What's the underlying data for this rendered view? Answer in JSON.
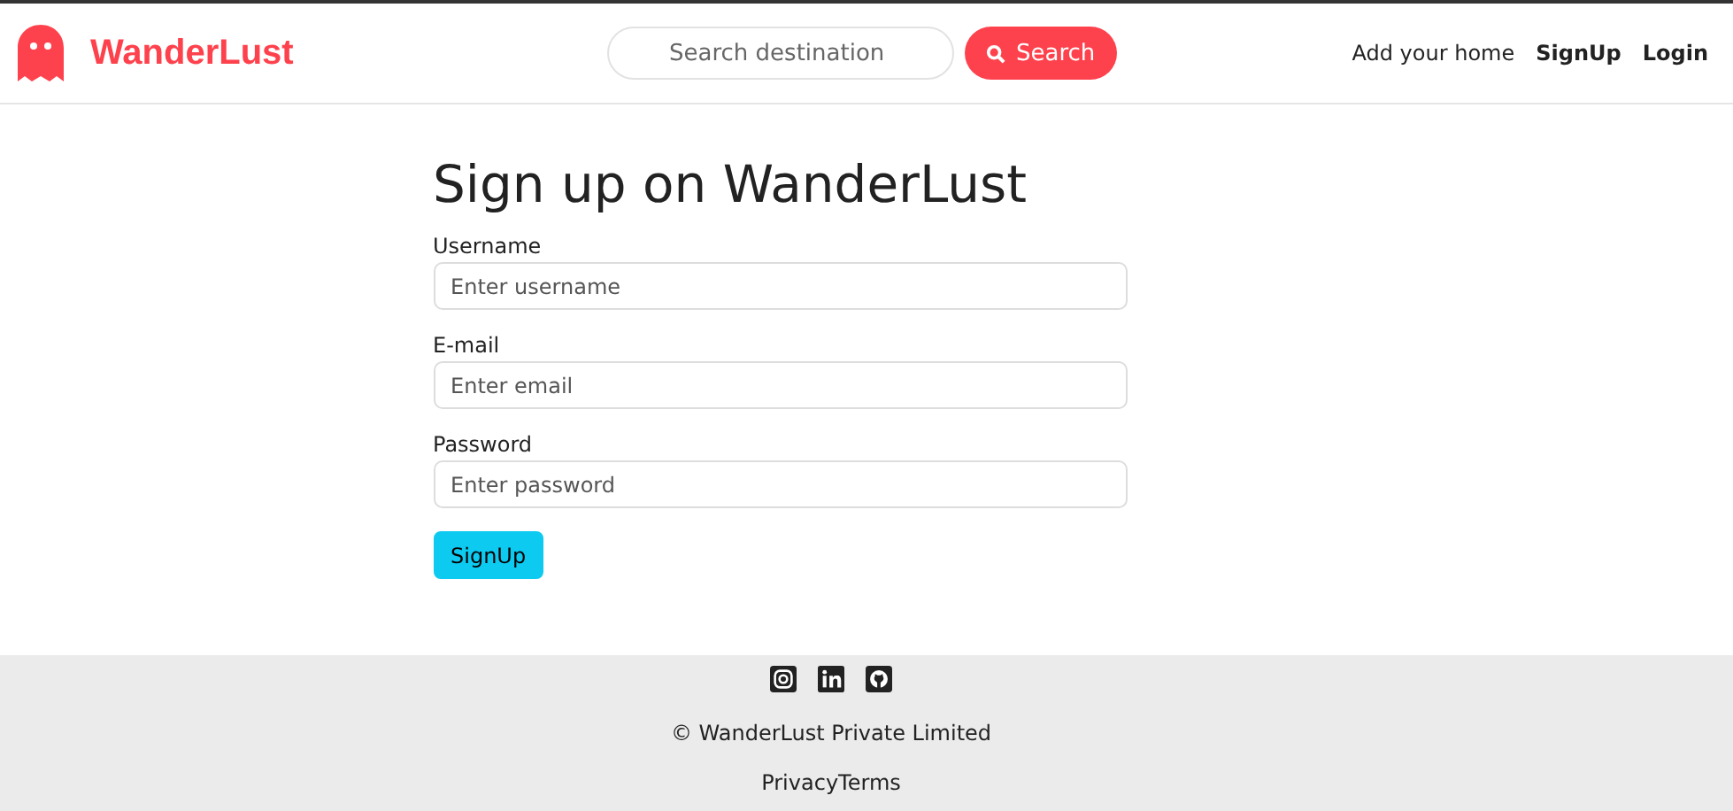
{
  "navbar": {
    "brand": "WanderLust",
    "search": {
      "placeholder": "Search destination",
      "button": "Search"
    },
    "links": [
      {
        "label": "Add your home",
        "bold": false
      },
      {
        "label": "SignUp",
        "bold": true
      },
      {
        "label": "Login",
        "bold": true
      }
    ]
  },
  "form": {
    "title": "Sign up on WanderLust",
    "fields": [
      {
        "label": "Username",
        "placeholder": "Enter username"
      },
      {
        "label": "E-mail",
        "placeholder": "Enter email"
      },
      {
        "label": "Password",
        "placeholder": "Enter password"
      }
    ],
    "submit": "SignUp"
  },
  "footer": {
    "social": [
      {
        "kind": "instagram"
      },
      {
        "kind": "linkedin"
      },
      {
        "kind": "github"
      }
    ],
    "copyright": "© WanderLust Private Limited",
    "links": [
      "Privacy",
      "Terms"
    ]
  }
}
